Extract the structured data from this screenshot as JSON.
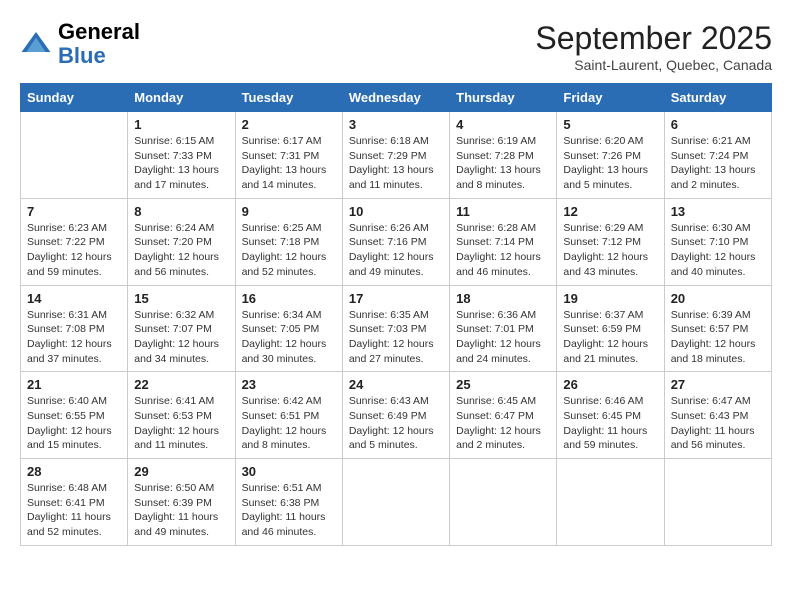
{
  "header": {
    "logo_general": "General",
    "logo_blue": "Blue",
    "month_title": "September 2025",
    "subtitle": "Saint-Laurent, Quebec, Canada"
  },
  "days_of_week": [
    "Sunday",
    "Monday",
    "Tuesday",
    "Wednesday",
    "Thursday",
    "Friday",
    "Saturday"
  ],
  "weeks": [
    [
      {
        "day": "",
        "info": ""
      },
      {
        "day": "1",
        "info": "Sunrise: 6:15 AM\nSunset: 7:33 PM\nDaylight: 13 hours\nand 17 minutes."
      },
      {
        "day": "2",
        "info": "Sunrise: 6:17 AM\nSunset: 7:31 PM\nDaylight: 13 hours\nand 14 minutes."
      },
      {
        "day": "3",
        "info": "Sunrise: 6:18 AM\nSunset: 7:29 PM\nDaylight: 13 hours\nand 11 minutes."
      },
      {
        "day": "4",
        "info": "Sunrise: 6:19 AM\nSunset: 7:28 PM\nDaylight: 13 hours\nand 8 minutes."
      },
      {
        "day": "5",
        "info": "Sunrise: 6:20 AM\nSunset: 7:26 PM\nDaylight: 13 hours\nand 5 minutes."
      },
      {
        "day": "6",
        "info": "Sunrise: 6:21 AM\nSunset: 7:24 PM\nDaylight: 13 hours\nand 2 minutes."
      }
    ],
    [
      {
        "day": "7",
        "info": "Sunrise: 6:23 AM\nSunset: 7:22 PM\nDaylight: 12 hours\nand 59 minutes."
      },
      {
        "day": "8",
        "info": "Sunrise: 6:24 AM\nSunset: 7:20 PM\nDaylight: 12 hours\nand 56 minutes."
      },
      {
        "day": "9",
        "info": "Sunrise: 6:25 AM\nSunset: 7:18 PM\nDaylight: 12 hours\nand 52 minutes."
      },
      {
        "day": "10",
        "info": "Sunrise: 6:26 AM\nSunset: 7:16 PM\nDaylight: 12 hours\nand 49 minutes."
      },
      {
        "day": "11",
        "info": "Sunrise: 6:28 AM\nSunset: 7:14 PM\nDaylight: 12 hours\nand 46 minutes."
      },
      {
        "day": "12",
        "info": "Sunrise: 6:29 AM\nSunset: 7:12 PM\nDaylight: 12 hours\nand 43 minutes."
      },
      {
        "day": "13",
        "info": "Sunrise: 6:30 AM\nSunset: 7:10 PM\nDaylight: 12 hours\nand 40 minutes."
      }
    ],
    [
      {
        "day": "14",
        "info": "Sunrise: 6:31 AM\nSunset: 7:08 PM\nDaylight: 12 hours\nand 37 minutes."
      },
      {
        "day": "15",
        "info": "Sunrise: 6:32 AM\nSunset: 7:07 PM\nDaylight: 12 hours\nand 34 minutes."
      },
      {
        "day": "16",
        "info": "Sunrise: 6:34 AM\nSunset: 7:05 PM\nDaylight: 12 hours\nand 30 minutes."
      },
      {
        "day": "17",
        "info": "Sunrise: 6:35 AM\nSunset: 7:03 PM\nDaylight: 12 hours\nand 27 minutes."
      },
      {
        "day": "18",
        "info": "Sunrise: 6:36 AM\nSunset: 7:01 PM\nDaylight: 12 hours\nand 24 minutes."
      },
      {
        "day": "19",
        "info": "Sunrise: 6:37 AM\nSunset: 6:59 PM\nDaylight: 12 hours\nand 21 minutes."
      },
      {
        "day": "20",
        "info": "Sunrise: 6:39 AM\nSunset: 6:57 PM\nDaylight: 12 hours\nand 18 minutes."
      }
    ],
    [
      {
        "day": "21",
        "info": "Sunrise: 6:40 AM\nSunset: 6:55 PM\nDaylight: 12 hours\nand 15 minutes."
      },
      {
        "day": "22",
        "info": "Sunrise: 6:41 AM\nSunset: 6:53 PM\nDaylight: 12 hours\nand 11 minutes."
      },
      {
        "day": "23",
        "info": "Sunrise: 6:42 AM\nSunset: 6:51 PM\nDaylight: 12 hours\nand 8 minutes."
      },
      {
        "day": "24",
        "info": "Sunrise: 6:43 AM\nSunset: 6:49 PM\nDaylight: 12 hours\nand 5 minutes."
      },
      {
        "day": "25",
        "info": "Sunrise: 6:45 AM\nSunset: 6:47 PM\nDaylight: 12 hours\nand 2 minutes."
      },
      {
        "day": "26",
        "info": "Sunrise: 6:46 AM\nSunset: 6:45 PM\nDaylight: 11 hours\nand 59 minutes."
      },
      {
        "day": "27",
        "info": "Sunrise: 6:47 AM\nSunset: 6:43 PM\nDaylight: 11 hours\nand 56 minutes."
      }
    ],
    [
      {
        "day": "28",
        "info": "Sunrise: 6:48 AM\nSunset: 6:41 PM\nDaylight: 11 hours\nand 52 minutes."
      },
      {
        "day": "29",
        "info": "Sunrise: 6:50 AM\nSunset: 6:39 PM\nDaylight: 11 hours\nand 49 minutes."
      },
      {
        "day": "30",
        "info": "Sunrise: 6:51 AM\nSunset: 6:38 PM\nDaylight: 11 hours\nand 46 minutes."
      },
      {
        "day": "",
        "info": ""
      },
      {
        "day": "",
        "info": ""
      },
      {
        "day": "",
        "info": ""
      },
      {
        "day": "",
        "info": ""
      }
    ]
  ]
}
